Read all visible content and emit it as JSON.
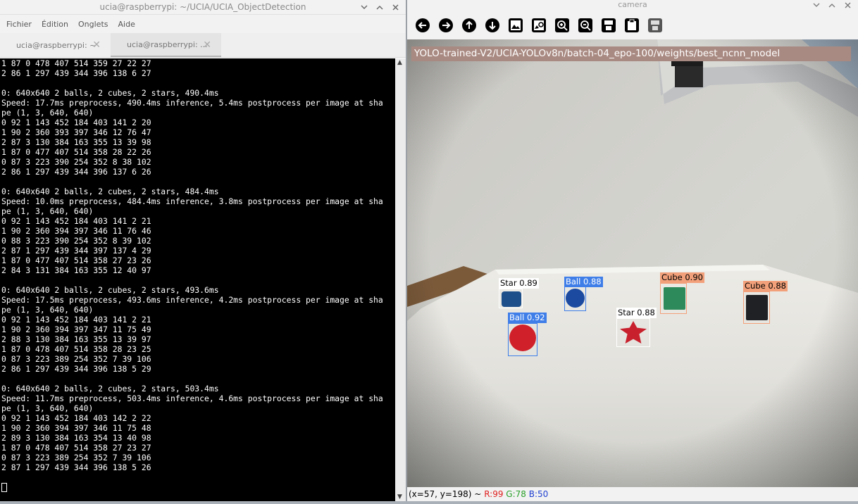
{
  "terminal": {
    "title": "ucia@raspberrypi: ~/UCIA/UCIA_ObjectDetection",
    "menu": [
      "Fichier",
      "Édition",
      "Onglets",
      "Aide"
    ],
    "tabs": [
      {
        "label": "ucia@raspberrypi: ~",
        "active": false
      },
      {
        "label": "ucia@raspberrypi: ...",
        "active": true
      }
    ],
    "lines": [
      "1 87 0 478 407 514 359 27 22 27",
      "2 86 1 297 439 344 396 138 6 27",
      "",
      "0: 640x640 2 balls, 2 cubes, 2 stars, 490.4ms",
      "Speed: 17.7ms preprocess, 490.4ms inference, 5.4ms postprocess per image at sha",
      "pe (1, 3, 640, 640)",
      "0 92 1 143 452 184 403 141 2 20",
      "1 90 2 360 393 397 346 12 76 47",
      "2 87 3 130 384 163 355 13 39 98",
      "1 87 0 477 407 514 358 28 22 26",
      "0 87 3 223 390 254 352 8 38 102",
      "2 86 1 297 439 344 396 137 6 26",
      "",
      "0: 640x640 2 balls, 2 cubes, 2 stars, 484.4ms",
      "Speed: 10.0ms preprocess, 484.4ms inference, 3.8ms postprocess per image at sha",
      "pe (1, 3, 640, 640)",
      "0 92 1 143 452 184 403 141 2 21",
      "1 90 2 360 394 397 346 11 76 46",
      "0 88 3 223 390 254 352 8 39 102",
      "2 87 1 297 439 344 397 137 4 29",
      "1 87 0 477 407 514 358 27 23 26",
      "2 84 3 131 384 163 355 12 40 97",
      "",
      "0: 640x640 2 balls, 2 cubes, 2 stars, 493.6ms",
      "Speed: 17.5ms preprocess, 493.6ms inference, 4.2ms postprocess per image at sha",
      "pe (1, 3, 640, 640)",
      "0 92 1 143 452 184 403 141 2 21",
      "1 90 2 360 394 397 347 11 75 49",
      "2 88 3 130 384 163 355 13 39 97",
      "1 87 0 478 407 514 358 28 23 25",
      "0 87 3 223 389 254 352 7 39 106",
      "2 86 1 297 439 344 396 138 5 29",
      "",
      "0: 640x640 2 balls, 2 cubes, 2 stars, 503.4ms",
      "Speed: 11.7ms preprocess, 503.4ms inference, 4.6ms postprocess per image at sha",
      "pe (1, 3, 640, 640)",
      "0 92 1 143 452 184 403 142 2 22",
      "1 90 2 360 394 397 346 11 75 48",
      "2 89 3 130 384 163 354 13 40 98",
      "1 87 0 478 407 514 358 27 23 27",
      "0 87 3 223 389 254 352 7 39 106",
      "2 87 1 297 439 344 396 138 5 26"
    ]
  },
  "camera": {
    "title": "camera",
    "toolbar": [
      "back-arrow-icon",
      "forward-arrow-icon",
      "up-arrow-icon",
      "down-arrow-icon",
      "image-icon",
      "image-settings-icon",
      "zoom-in-icon",
      "zoom-out-icon",
      "save-icon",
      "clipboard-icon",
      "save-to-device-icon"
    ],
    "overlay_text": "YOLO-trained-V2/UCIA-YOLOv8n/batch-04_epo-100/weights/best_ncnn_model",
    "detections": [
      {
        "label": "Star 0.89",
        "color": "#ffffff"
      },
      {
        "label": "Ball 0.88",
        "color": "#3f7ee8"
      },
      {
        "label": "Cube 0.90",
        "color": "#f2a07a"
      },
      {
        "label": "Cube 0.88",
        "color": "#f2a07a"
      },
      {
        "label": "Star 0.88",
        "color": "#ffffff"
      },
      {
        "label": "Ball 0.92",
        "color": "#3f7ee8"
      }
    ],
    "status": {
      "coords": "(x=57, y=198) ~",
      "r": "R:99",
      "g": "G:78",
      "b": "B:50"
    }
  },
  "colors": {
    "r": "#e02020",
    "g": "#2aa02a",
    "b": "#1f3fd0"
  }
}
